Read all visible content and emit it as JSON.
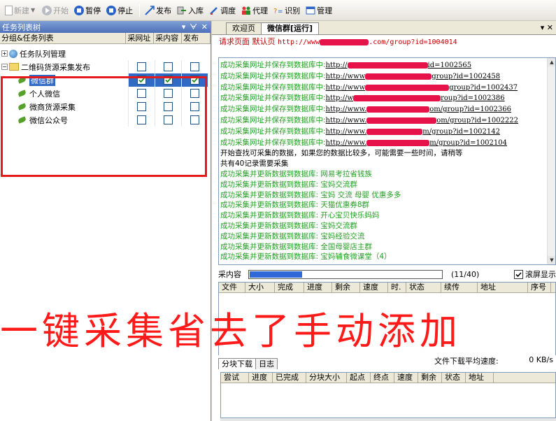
{
  "toolbar": {
    "new_label": "新建",
    "start_label": "开始",
    "pause_label": "暂停",
    "stop_label": "停止",
    "publish_label": "发布",
    "import_label": "入库",
    "debug_label": "调度",
    "proxy_label": "代理",
    "recognize_label": "识别",
    "manage_label": "管理"
  },
  "left_panel": {
    "title": "任务列表树",
    "title_controls": [
      "▾",
      "ᗄ",
      "✕"
    ],
    "columns": [
      "分组&任务列表",
      "采网址",
      "采内容",
      "发布"
    ],
    "rows": [
      {
        "label": "任务队列管理",
        "kind": "queue",
        "checks": null
      },
      {
        "label": "二维码货源采集发布",
        "kind": "folder",
        "checks": [
          false,
          false,
          false
        ]
      },
      {
        "label": "微信群",
        "kind": "task",
        "selected": true,
        "checks": [
          true,
          true,
          true
        ]
      },
      {
        "label": "个人微信",
        "kind": "task",
        "checks": [
          false,
          false,
          false
        ]
      },
      {
        "label": "微商货源采集",
        "kind": "task",
        "checks": [
          false,
          false,
          false
        ]
      },
      {
        "label": "微信公众号",
        "kind": "task",
        "checks": [
          false,
          false,
          false
        ]
      }
    ]
  },
  "tabs": {
    "welcome": "欢迎页",
    "active": "微信群[运行]",
    "close": "▾ ✕"
  },
  "url_line": {
    "label1": "请求页面",
    "label2": "默认页",
    "url_prefix": "http://www",
    "url_suffix": ".com/group?id=1004014"
  },
  "log": {
    "url_saved": [
      {
        "text": "成功采集网址并保存到数据库中:",
        "prefix": "http://",
        "suffix": "id=1002565"
      },
      {
        "text": "成功采集网址并保存到数据库中:",
        "prefix": "http://www",
        "suffix": "group?id=1002458"
      },
      {
        "text": "成功采集网址并保存到数据库中:",
        "prefix": "http://www",
        "suffix": "group?id=1002437"
      },
      {
        "text": "成功采集网址并保存到数据库中:",
        "prefix": "http://w",
        "suffix": "roup?id=1002386"
      },
      {
        "text": "成功采集网址并保存到数据库中:",
        "prefix": "http://www.",
        "suffix": "om/group?id=1002366"
      },
      {
        "text": "成功采集网址并保存到数据库中:",
        "prefix": "http://www.",
        "suffix": "om/group?id=1002222"
      },
      {
        "text": "成功采集网址并保存到数据库中:",
        "prefix": "http://www.",
        "suffix": "m/group?id=1002142"
      },
      {
        "text": "成功采集网址并保存到数据库中:",
        "prefix": "http://www.",
        "suffix": "m/group?id=1002104"
      }
    ],
    "notice1": "开始查找可采集的数据，如果您的数据比较多，可能需要一些时间，请稍等",
    "notice2": "共有40记录需要采集",
    "data_saved": [
      "成功采集并更新数据到数据库: 网易考拉省钱族",
      "成功采集并更新数据到数据库: 宝妈交流群",
      "成功采集并更新数据到数据库: 宝妈 交流  母婴   优惠多多",
      "成功采集并更新数据到数据库: 天猫优惠券8群",
      "成功采集并更新数据到数据库: 开心宝贝快乐妈妈",
      "成功采集并更新数据到数据库: 宝妈交流群",
      "成功采集并更新数据到数据库: 宝妈经验交流",
      "成功采集并更新数据到数据库: 全国母婴店主群",
      "成功采集并更新数据到数据库: 宝妈辅食微课堂（4）"
    ]
  },
  "progress": {
    "label": "采内容",
    "count": "(11/40)",
    "fraction": 0.275,
    "fullscreen_label": "滚屏显示",
    "fullscreen_checked": true
  },
  "file_table": {
    "columns": [
      "文件",
      "大小",
      "完成",
      "进度",
      "剩余",
      "速度",
      "时.",
      "状态",
      "续传",
      "地址",
      "序号"
    ]
  },
  "lower_tabs": {
    "block_download": "分块下载",
    "log": "日志"
  },
  "avg_speed": {
    "label": "文件下载平均速度:",
    "value": "0 KB/s"
  },
  "block_table": {
    "columns": [
      "尝试",
      "进度",
      "已完成",
      "分块大小",
      "起点",
      "终点",
      "速度",
      "剩余",
      "状态",
      "地址"
    ]
  },
  "overlay": {
    "text": "一键采集省去了手动添加"
  },
  "colors": {
    "accent_blue": "#316ac5",
    "success_green": "#23a023",
    "highlight_red": "#e51b1b",
    "title_red": "#ff1a1a"
  }
}
